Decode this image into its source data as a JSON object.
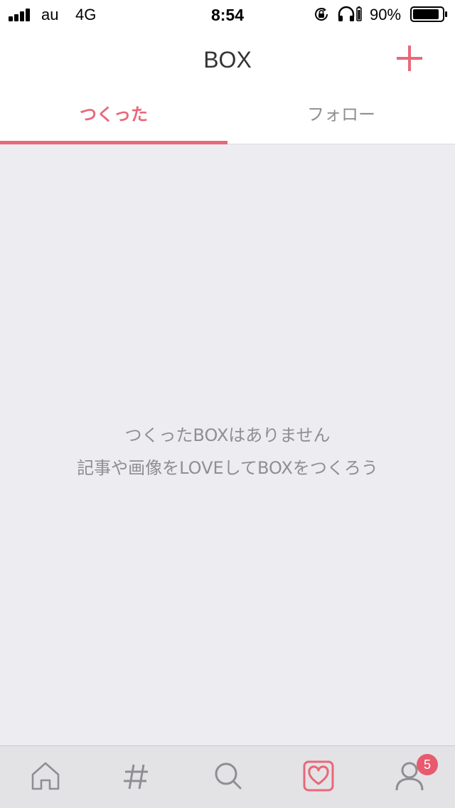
{
  "status_bar": {
    "carrier": "au",
    "network": "4G",
    "time": "8:54",
    "battery_percent": "90%",
    "battery_level": 0.9,
    "icons": [
      "signal-icon",
      "rotation-lock-icon",
      "headphones-icon",
      "battery-icon"
    ]
  },
  "nav": {
    "title": "BOX",
    "add_icon": "plus-icon"
  },
  "tabs": [
    {
      "label": "つくった",
      "active": true
    },
    {
      "label": "フォロー",
      "active": false
    }
  ],
  "empty_state": {
    "line1": "つくったBOXはありません",
    "line2": "記事や画像をLOVEしてBOXをつくろう"
  },
  "tab_bar": {
    "items": [
      {
        "icon": "home-icon",
        "active": false
      },
      {
        "icon": "hashtag-icon",
        "active": false
      },
      {
        "icon": "search-icon",
        "active": false
      },
      {
        "icon": "heart-box-icon",
        "active": true
      },
      {
        "icon": "profile-icon",
        "active": false
      }
    ],
    "profile_badge": "5"
  },
  "colors": {
    "accent": "#e8687a",
    "badge": "#e85a6e",
    "content_bg": "#ededf1",
    "tab_bar_bg": "#e3e3e6",
    "inactive_icon": "#8e8e93"
  }
}
